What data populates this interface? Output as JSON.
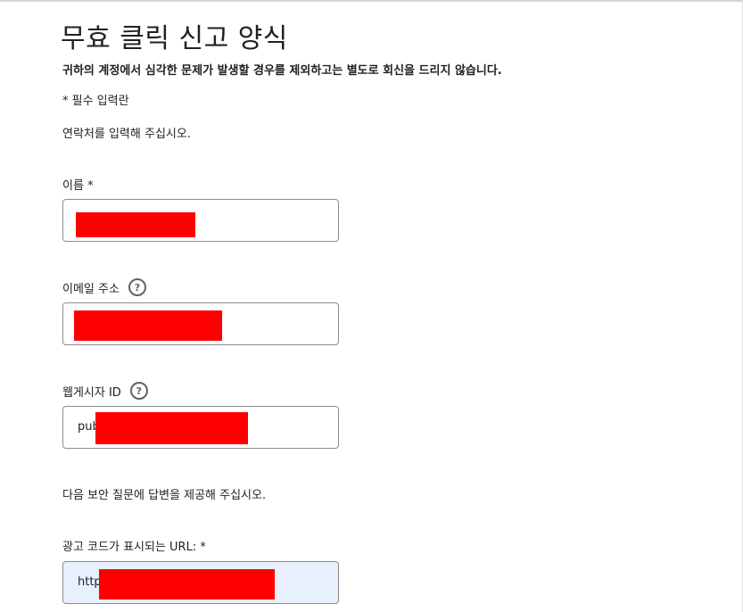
{
  "form": {
    "title": "무효 클릭 신고 양식",
    "subtitle": "귀하의 계정에서 심각한 문제가 발생할 경우를 제외하고는 별도로 회신을 드리지 않습니다.",
    "required_note": "* 필수 입력란",
    "contact_note": "연락처를 입력해 주십시오.",
    "security_note": "다음 보안 질문에 답변을 제공해 주십시오."
  },
  "fields": {
    "name": {
      "label": "이름 *",
      "value": ""
    },
    "email": {
      "label": "이메일 주소",
      "value": "",
      "help_icon": "question-circle-icon"
    },
    "publisher_id": {
      "label": "웹게시자 ID",
      "value": "pub",
      "help_icon": "question-circle-icon"
    },
    "ad_url": {
      "label": "광고 코드가 표시되는 URL: *",
      "value": "http"
    }
  },
  "colors": {
    "redaction": "#ff0000",
    "autofill_background": "#e8f0fe",
    "field_border": "#8c8c8c"
  }
}
